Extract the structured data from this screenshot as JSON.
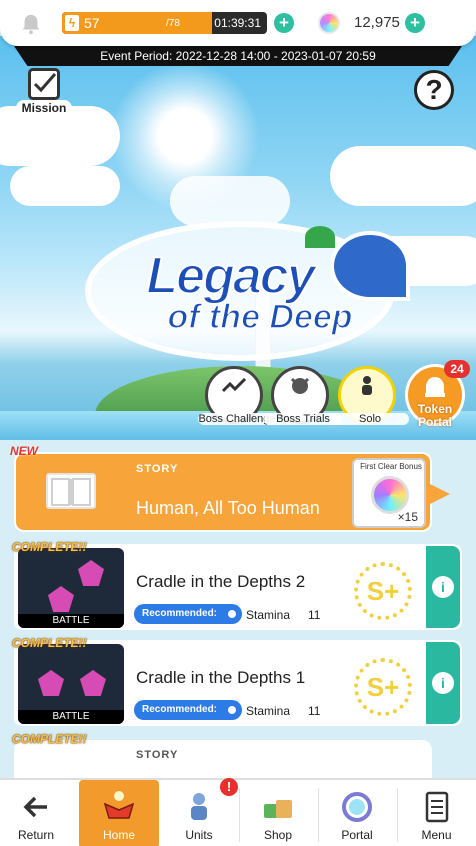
{
  "status_bar": {
    "stamina_current": "57",
    "stamina_max": "/78",
    "stamina_fraction": 0.73,
    "timer": "01:39:31",
    "gem_count": "12,975",
    "bell_icon": "bell-icon",
    "colors": {
      "stamina": "#f39a1d",
      "plus": "#2dbf9f"
    }
  },
  "event": {
    "period": "Event Period: 2022-12-28 14:00 - 2023-01-07 20:59"
  },
  "banner": {
    "logo_line1": "Legacy",
    "logo_line2": "of the Deep",
    "mission_label": "Mission",
    "help_label": "?",
    "buttons": [
      {
        "label": "Boss Challenge",
        "icon": "chart-trend-icon"
      },
      {
        "label": "Boss Trials",
        "icon": "demon-face-icon"
      },
      {
        "label": "Solo",
        "icon": "solo-figure-icon"
      }
    ],
    "token_portal": {
      "label": "Token Portal",
      "badge": "24"
    }
  },
  "stages": {
    "new_tag": "NEW",
    "story": {
      "tag": "STORY",
      "title": "Human, All Too Human",
      "bonus_label": "First Clear Bonus",
      "bonus_count": "×15"
    },
    "battles": [
      {
        "complete_tag": "COMPLETE!!",
        "thumb_caption": "BATTLE",
        "title": "Cradle in the Depths 2",
        "recommended_label": "Recommended:",
        "stamina_label": "Stamina",
        "stamina_cost": "11",
        "rank": "S+"
      },
      {
        "complete_tag": "COMPLETE!!",
        "thumb_caption": "BATTLE",
        "title": "Cradle in the Depths 1",
        "recommended_label": "Recommended:",
        "stamina_label": "Stamina",
        "stamina_cost": "11",
        "rank": "S+"
      }
    ],
    "partial_story": {
      "complete_tag": "COMPLETE!!",
      "tag": "STORY"
    }
  },
  "nav": {
    "items": [
      {
        "label": "Return",
        "icon": "arrow-left-icon"
      },
      {
        "label": "Home",
        "icon": "home-crest-icon"
      },
      {
        "label": "Units",
        "icon": "unit-figure-icon"
      },
      {
        "label": "Shop",
        "icon": "shop-bags-icon"
      },
      {
        "label": "Portal",
        "icon": "portal-gate-icon"
      },
      {
        "label": "Menu",
        "icon": "menu-list-icon"
      }
    ],
    "units_badge": "!"
  }
}
